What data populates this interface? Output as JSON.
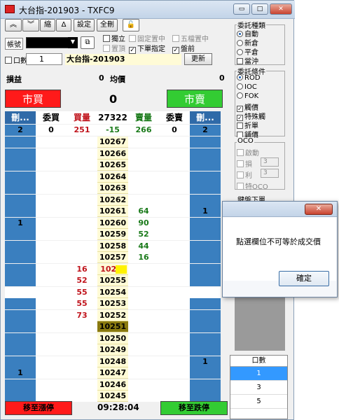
{
  "window": {
    "title": "大台指-201903 - TXFC9",
    "min_glyph": "▭",
    "max_glyph": "□",
    "close_glyph": "✕"
  },
  "toolbar": {
    "up_glyph": "︽",
    "down_glyph": "︾",
    "shrink": "縮",
    "delta": "Δ",
    "settings": "設定",
    "delete_all": "全刪",
    "lock_glyph": "🔓"
  },
  "options": {
    "independent": "獨立",
    "fixed_center": "固定置中",
    "five_center": "五檔置中",
    "top": "置頂",
    "order_specify": "下單指定",
    "after_hours": "盤前",
    "check_glyph": "✓"
  },
  "account": {
    "label": "帳號",
    "dropdown_glyph": "▼",
    "icon_glyph": "⧉"
  },
  "quantity": {
    "label": "口數",
    "value": "1"
  },
  "contract_name": "大台指-201903",
  "refresh_label": "更新",
  "pnl": {
    "pnl_label": "損益",
    "pnl_value": "0",
    "avg_label": "均價",
    "avg_value": "0"
  },
  "market_buy": "市買",
  "market_sell": "市賣",
  "center_value": "0",
  "colors": {
    "market_buy_bg": "#ff1a1a",
    "market_sell_bg": "#33cc33",
    "header_blue": "#2f6aa8",
    "col_blue": "#3a7fbf",
    "buy_red": "#c0141c",
    "sell_green": "#1a7a1a",
    "price_yellow": "#fffbd6",
    "last_trade_bg": "#8a7a10",
    "highlight_yellow": "#fff200"
  },
  "ladder": {
    "headers": [
      "刪...",
      "委買",
      "買量",
      "27322",
      "賣量",
      "委賣",
      "刪..."
    ],
    "summary": {
      "del_buy": "2",
      "order_buy": "0",
      "buy_vol": "251",
      "change": "-15",
      "sell_vol": "266",
      "order_sell": "0",
      "del_sell": "2"
    },
    "rows": [
      {
        "price": "10267",
        "del_buy": "",
        "buy": "",
        "sell": "",
        "del_sell": ""
      },
      {
        "price": "10266",
        "del_buy": "",
        "buy": "",
        "sell": "",
        "del_sell": ""
      },
      {
        "price": "10265",
        "del_buy": "",
        "buy": "",
        "sell": "",
        "del_sell": ""
      },
      {
        "price": "10264",
        "del_buy": "",
        "buy": "",
        "sell": "",
        "del_sell": ""
      },
      {
        "price": "10263",
        "del_buy": "",
        "buy": "",
        "sell": "",
        "del_sell": ""
      },
      {
        "price": "10262",
        "del_buy": "",
        "buy": "",
        "sell": "",
        "del_sell": ""
      },
      {
        "price": "10261",
        "del_buy": "",
        "buy": "",
        "sell": "64",
        "del_sell": "1"
      },
      {
        "price": "10260",
        "del_buy": "1",
        "buy": "",
        "sell": "90",
        "del_sell": ""
      },
      {
        "price": "10259",
        "del_buy": "",
        "buy": "",
        "sell": "52",
        "del_sell": ""
      },
      {
        "price": "10258",
        "del_buy": "",
        "buy": "",
        "sell": "44",
        "del_sell": ""
      },
      {
        "price": "10257",
        "del_buy": "",
        "buy": "",
        "sell": "16",
        "del_sell": ""
      },
      {
        "price": "102...",
        "del_buy": "",
        "buy": "16",
        "sell": "",
        "del_sell": "",
        "highlight": true
      },
      {
        "price": "10255",
        "del_buy": "",
        "buy": "52",
        "sell": "",
        "del_sell": ""
      },
      {
        "price": "10254",
        "del_buy": "",
        "buy": "55",
        "sell": "",
        "del_sell": "",
        "white_row": true
      },
      {
        "price": "10253",
        "del_buy": "",
        "buy": "55",
        "sell": "",
        "del_sell": ""
      },
      {
        "price": "10252",
        "del_buy": "",
        "buy": "73",
        "sell": "",
        "del_sell": ""
      },
      {
        "price": "10251",
        "del_buy": "",
        "buy": "",
        "sell": "",
        "del_sell": "",
        "last_trade": true
      },
      {
        "price": "10250",
        "del_buy": "",
        "buy": "",
        "sell": "",
        "del_sell": ""
      },
      {
        "price": "10249",
        "del_buy": "",
        "buy": "",
        "sell": "",
        "del_sell": ""
      },
      {
        "price": "10248",
        "del_buy": "",
        "buy": "",
        "sell": "",
        "del_sell": "1"
      },
      {
        "price": "10247",
        "del_buy": "1",
        "buy": "",
        "sell": "",
        "del_sell": ""
      },
      {
        "price": "10246",
        "del_buy": "",
        "buy": "",
        "sell": "",
        "del_sell": ""
      },
      {
        "price": "10245",
        "del_buy": "",
        "buy": "",
        "sell": "",
        "del_sell": ""
      }
    ]
  },
  "footer": {
    "move_limit_up": "移至漲停",
    "time": "09:28:04",
    "move_limit_down": "移至跌停"
  },
  "order_type": {
    "title": "委託種類",
    "options": [
      "自動",
      "新倉",
      "平倉",
      "當沖"
    ],
    "selected": "自動"
  },
  "order_cond": {
    "title": "委託條件",
    "options": [
      "ROD",
      "IOC",
      "FOK"
    ],
    "selected": "ROD",
    "checks": [
      "觸價",
      "特殊觸",
      "折單",
      "鋪價"
    ]
  },
  "oco": {
    "title": "OCO",
    "enable": "啟動",
    "loss": "損",
    "profit": "利",
    "loss_value": "3",
    "profit_value": "3",
    "special": "特OCO"
  },
  "keyboard": "鍵盤下單",
  "qty_list": {
    "title": "口數",
    "items": [
      "1",
      "3",
      "5"
    ]
  },
  "dialog": {
    "message": "點選欄位不可等於成交價",
    "ok": "確定",
    "close_glyph": "✕"
  }
}
